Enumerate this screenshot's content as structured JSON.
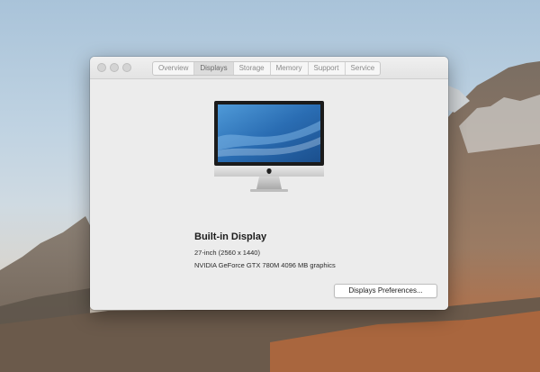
{
  "window": {
    "tabs": [
      {
        "label": "Overview",
        "selected": false
      },
      {
        "label": "Displays",
        "selected": true
      },
      {
        "label": "Storage",
        "selected": false
      },
      {
        "label": "Memory",
        "selected": false
      },
      {
        "label": "Support",
        "selected": false
      },
      {
        "label": "Service",
        "selected": false
      }
    ]
  },
  "display": {
    "title": "Built-in Display",
    "size": "27-inch (2560 x 1440)",
    "graphics": "NVIDIA GeForce GTX 780M 4096 MB graphics",
    "icon": "imac-icon"
  },
  "buttons": {
    "preferences_label": "Displays Preferences..."
  },
  "colors": {
    "window_bg": "#ececec",
    "screen_blue": "#2f6fb3"
  }
}
